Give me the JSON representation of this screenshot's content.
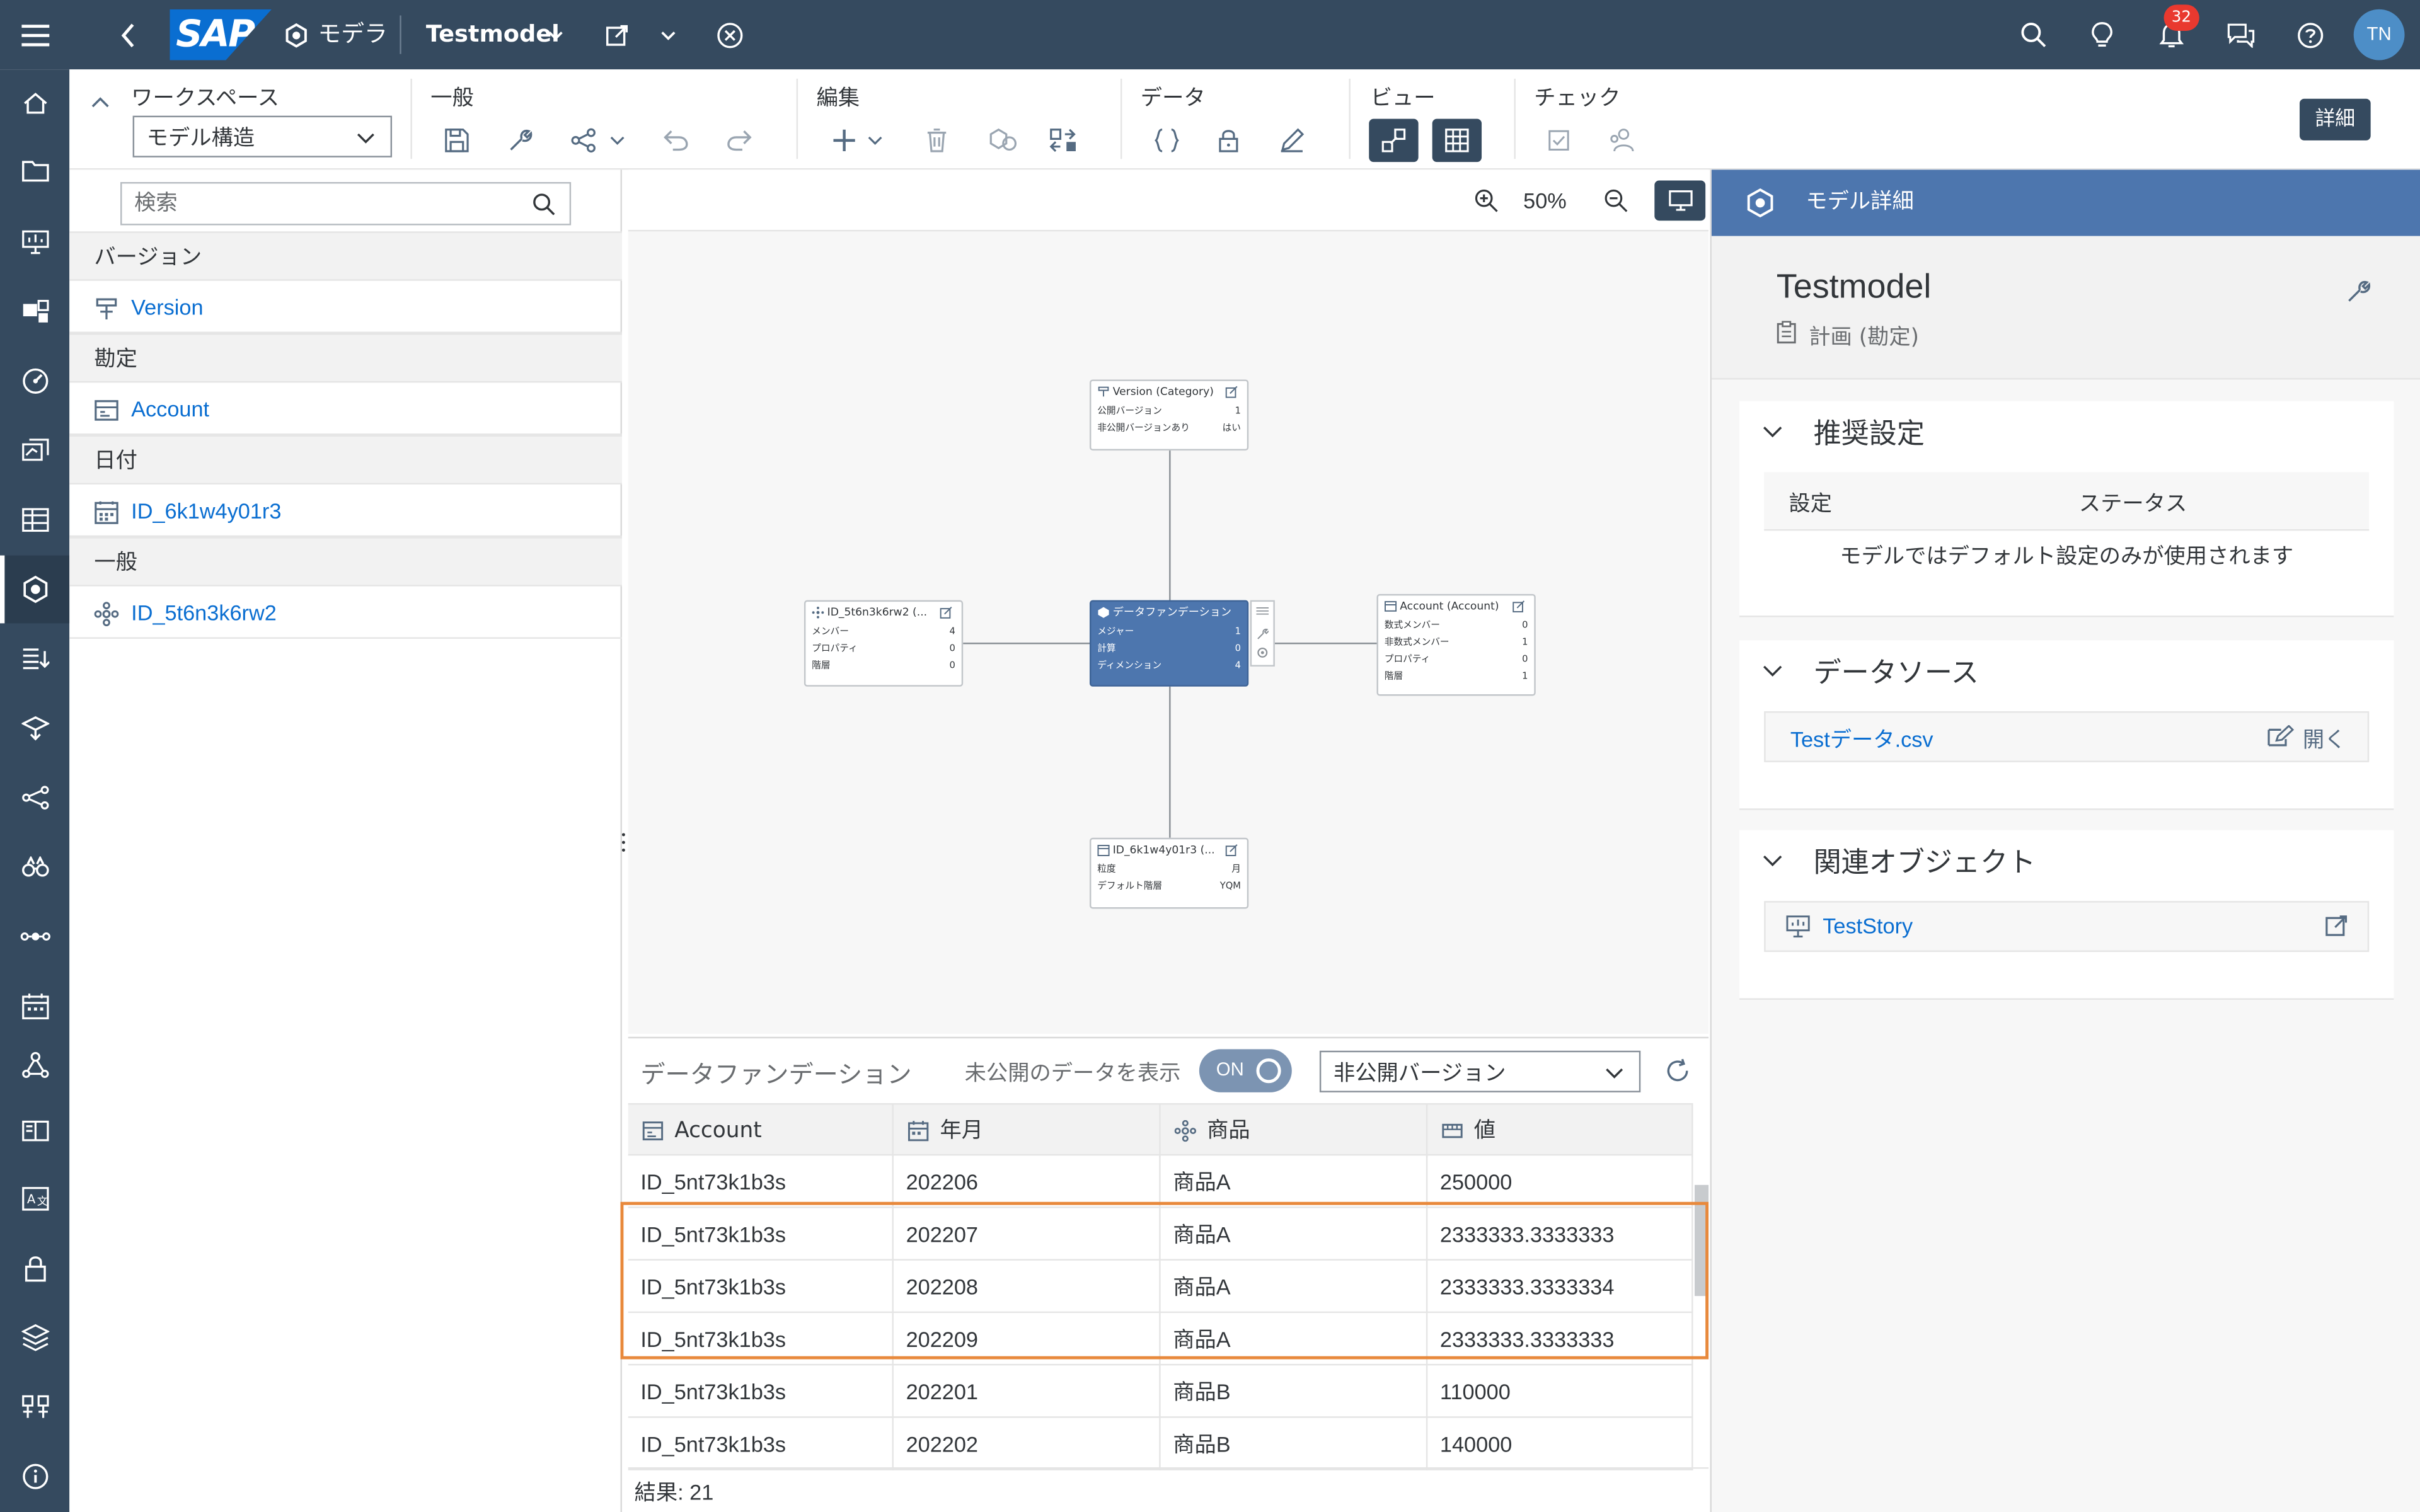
{
  "shell": {
    "app_name": "モデラ",
    "model_name": "Testmodel",
    "notification_count": "32",
    "user_initials": "TN"
  },
  "toolbar": {
    "workspace_label": "ワークスペース",
    "workspace_value": "モデル構造",
    "general_label": "一般",
    "edit_label": "編集",
    "data_label": "データ",
    "view_label": "ビュー",
    "check_label": "チェック",
    "details_label": "詳細"
  },
  "left_panel": {
    "search_placeholder": "検索",
    "groups": [
      {
        "title": "バージョン",
        "item": "Version",
        "icon": "version-icon"
      },
      {
        "title": "勘定",
        "item": "Account",
        "icon": "account-icon"
      },
      {
        "title": "日付",
        "item": "ID_6k1w4y01r3",
        "icon": "calendar-icon"
      },
      {
        "title": "一般",
        "item": "ID_5t6n3k6rw2",
        "icon": "generic-dimension-icon"
      }
    ]
  },
  "canvas": {
    "zoom": "50%",
    "nodes": {
      "version": {
        "title": "Version (Category)",
        "rows": [
          [
            "公開バージョン",
            "1"
          ],
          [
            "非公開バージョンあり",
            "はい"
          ]
        ]
      },
      "generic": {
        "title": "ID_5t6n3k6rw2 (...",
        "rows": [
          [
            "メンバー",
            "4"
          ],
          [
            "プロパティ",
            "0"
          ],
          [
            "階層",
            "0"
          ]
        ]
      },
      "center": {
        "title": "データファンデーション",
        "rows": [
          [
            "メジャー",
            "1"
          ],
          [
            "計算",
            "0"
          ],
          [
            "ディメンション",
            "4"
          ]
        ]
      },
      "account": {
        "title": "Account (Account)",
        "rows": [
          [
            "数式メンバー",
            "0"
          ],
          [
            "非数式メンバー",
            "1"
          ],
          [
            "プロパティ",
            "0"
          ],
          [
            "階層",
            "1"
          ]
        ]
      },
      "date": {
        "title": "ID_6k1w4y01r3 (...",
        "rows": [
          [
            "粒度",
            "月"
          ],
          [
            "デフォルト階層",
            "YQM"
          ]
        ]
      }
    }
  },
  "grid": {
    "title": "データファンデーション",
    "show_unpublished_label": "未公開のデータを表示",
    "toggle_label": "ON",
    "version_select": "非公開バージョン",
    "columns": [
      "Account",
      "年月",
      "商品",
      "値"
    ],
    "rows": [
      [
        "ID_5nt73k1b3s",
        "202206",
        "商品A",
        "250000"
      ],
      [
        "ID_5nt73k1b3s",
        "202207",
        "商品A",
        "2333333.3333333"
      ],
      [
        "ID_5nt73k1b3s",
        "202208",
        "商品A",
        "2333333.3333334"
      ],
      [
        "ID_5nt73k1b3s",
        "202209",
        "商品A",
        "2333333.3333333"
      ],
      [
        "ID_5nt73k1b3s",
        "202201",
        "商品B",
        "110000"
      ],
      [
        "ID_5nt73k1b3s",
        "202202",
        "商品B",
        "140000"
      ]
    ],
    "result_label": "結果: 21"
  },
  "right_panel": {
    "header": "モデル詳細",
    "model_name": "Testmodel",
    "model_type": "計画 (勘定)",
    "recommend_title": "推奨設定",
    "col_setting": "設定",
    "col_status": "ステータス",
    "recommend_note": "モデルではデフォルト設定のみが使用されます",
    "datasource_title": "データソース",
    "datasource_file": "Testデータ.csv",
    "open_label": "開く",
    "related_title": "関連オブジェクト",
    "related_item": "TestStory"
  }
}
